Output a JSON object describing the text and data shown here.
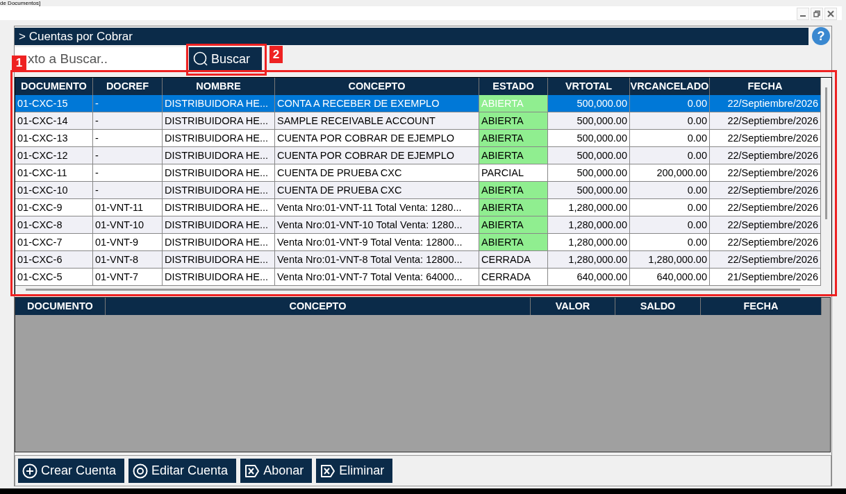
{
  "window": {
    "title": "de Documentos]"
  },
  "panel": {
    "title": "> Cuentas por Cobrar",
    "help": "?"
  },
  "search": {
    "placeholder": "xto a Buscar..",
    "button": "Buscar"
  },
  "table": {
    "columns": [
      "DOCUMENTO",
      "DOCREF",
      "NOMBRE",
      "CONCEPTO",
      "ESTADO",
      "VRTOTAL",
      "VRCANCELADO",
      "FECHA"
    ],
    "rows": [
      {
        "selected": true,
        "status_highlight": true,
        "cells": [
          "01-CXC-15",
          "-",
          "DISTRIBUIDORA HE...",
          "CONTA A RECEBER DE EXEMPLO",
          "ABIERTA",
          "500,000.00",
          "0.00",
          "22/Septiembre/2026"
        ]
      },
      {
        "selected": false,
        "status_highlight": true,
        "cells": [
          "01-CXC-14",
          "-",
          "DISTRIBUIDORA HE...",
          "SAMPLE RECEIVABLE ACCOUNT",
          "ABIERTA",
          "500,000.00",
          "0.00",
          "22/Septiembre/2026"
        ]
      },
      {
        "selected": false,
        "status_highlight": true,
        "cells": [
          "01-CXC-13",
          "-",
          "DISTRIBUIDORA HE...",
          "CUENTA POR COBRAR DE EJEMPLO",
          "ABIERTA",
          "500,000.00",
          "0.00",
          "22/Septiembre/2026"
        ]
      },
      {
        "selected": false,
        "status_highlight": true,
        "cells": [
          "01-CXC-12",
          "-",
          "DISTRIBUIDORA HE...",
          "CUENTA POR COBRAR DE EJEMPLO",
          "ABIERTA",
          "500,000.00",
          "0.00",
          "22/Septiembre/2026"
        ]
      },
      {
        "selected": false,
        "status_highlight": false,
        "cells": [
          "01-CXC-11",
          "-",
          "DISTRIBUIDORA HE...",
          "CUENTA DE PRUEBA CXC",
          "PARCIAL",
          "500,000.00",
          "200,000.00",
          "22/Septiembre/2026"
        ]
      },
      {
        "selected": false,
        "status_highlight": true,
        "cells": [
          "01-CXC-10",
          "-",
          "DISTRIBUIDORA HE...",
          "CUENTA DE PRUEBA CXC",
          "ABIERTA",
          "500,000.00",
          "0.00",
          "22/Septiembre/2026"
        ]
      },
      {
        "selected": false,
        "status_highlight": true,
        "cells": [
          "01-CXC-9",
          "01-VNT-11",
          "DISTRIBUIDORA HE...",
          "Venta Nro:01-VNT-11 Total Venta: 1280...",
          "ABIERTA",
          "1,280,000.00",
          "0.00",
          "22/Septiembre/2026"
        ]
      },
      {
        "selected": false,
        "status_highlight": true,
        "cells": [
          "01-CXC-8",
          "01-VNT-10",
          "DISTRIBUIDORA HE...",
          "Venta Nro:01-VNT-10 Total Venta: 1280...",
          "ABIERTA",
          "1,280,000.00",
          "0.00",
          "22/Septiembre/2026"
        ]
      },
      {
        "selected": false,
        "status_highlight": true,
        "cells": [
          "01-CXC-7",
          "01-VNT-9",
          "DISTRIBUIDORA HE...",
          "Venta Nro:01-VNT-9 Total Venta: 12800...",
          "ABIERTA",
          "1,280,000.00",
          "0.00",
          "22/Septiembre/2026"
        ]
      },
      {
        "selected": false,
        "status_highlight": false,
        "cells": [
          "01-CXC-6",
          "01-VNT-8",
          "DISTRIBUIDORA HE...",
          "Venta Nro:01-VNT-8 Total Venta: 12800...",
          "CERRADA",
          "1,280,000.00",
          "1,280,000.00",
          "22/Septiembre/2026"
        ]
      },
      {
        "selected": false,
        "status_highlight": false,
        "cells": [
          "01-CXC-5",
          "01-VNT-7",
          "DISTRIBUIDORA HE...",
          "Venta Nro:01-VNT-7 Total Venta: 64000...",
          "CERRADA",
          "640,000.00",
          "640,000.00",
          "21/Septiembre/2026"
        ]
      }
    ]
  },
  "detail_table": {
    "columns": [
      "DOCUMENTO",
      "CONCEPTO",
      "VALOR",
      "SALDO",
      "FECHA"
    ]
  },
  "actions": [
    {
      "label": "Crear Cuenta",
      "kind": "plus"
    },
    {
      "label": "Editar Cuenta",
      "kind": "eye"
    },
    {
      "label": "Abonar",
      "kind": "erase"
    },
    {
      "label": "Eliminar",
      "kind": "erase"
    }
  ],
  "callouts": [
    "1",
    "2"
  ]
}
